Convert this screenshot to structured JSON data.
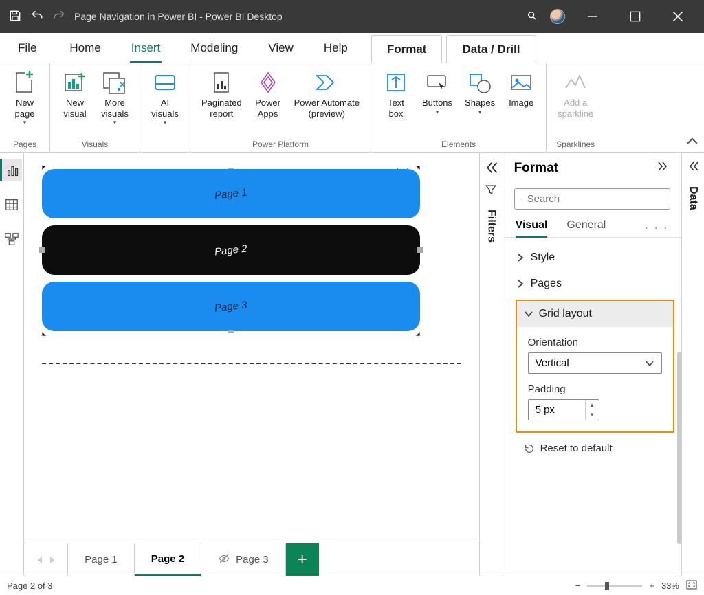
{
  "titlebar": {
    "title": "Page Navigation in Power BI - Power BI Desktop"
  },
  "maintabs": {
    "file": "File",
    "home": "Home",
    "insert": "Insert",
    "modeling": "Modeling",
    "view": "View",
    "help": "Help",
    "format": "Format",
    "datadrill": "Data / Drill"
  },
  "ribbon": {
    "pages_group": "Pages",
    "visuals_group": "Visuals",
    "powerplatform_group": "Power Platform",
    "elements_group": "Elements",
    "sparklines_group": "Sparklines",
    "new_page": "New\npage",
    "new_visual": "New\nvisual",
    "more_visuals": "More\nvisuals",
    "ai_visuals": "AI\nvisuals",
    "paginated_report": "Paginated\nreport",
    "power_apps": "Power\nApps",
    "power_automate": "Power Automate\n(preview)",
    "text_box": "Text\nbox",
    "buttons": "Buttons",
    "shapes": "Shapes",
    "image": "Image",
    "add_sparkline": "Add a\nsparkline"
  },
  "canvas": {
    "nav1": "Page 1",
    "nav2": "Page 2",
    "nav3": "Page 3"
  },
  "pagetabs": {
    "p1": "Page 1",
    "p2": "Page 2",
    "p3": "Page 3"
  },
  "filters": {
    "label": "Filters"
  },
  "format": {
    "header": "Format",
    "search_placeholder": "Search",
    "tab_visual": "Visual",
    "tab_general": "General",
    "section_style": "Style",
    "section_pages": "Pages",
    "section_grid": "Grid layout",
    "orientation_label": "Orientation",
    "orientation_value": "Vertical",
    "padding_label": "Padding",
    "padding_value": "5 px",
    "reset": "Reset to default"
  },
  "data": {
    "label": "Data"
  },
  "status": {
    "page": "Page 2 of 3",
    "zoom": "33%"
  }
}
